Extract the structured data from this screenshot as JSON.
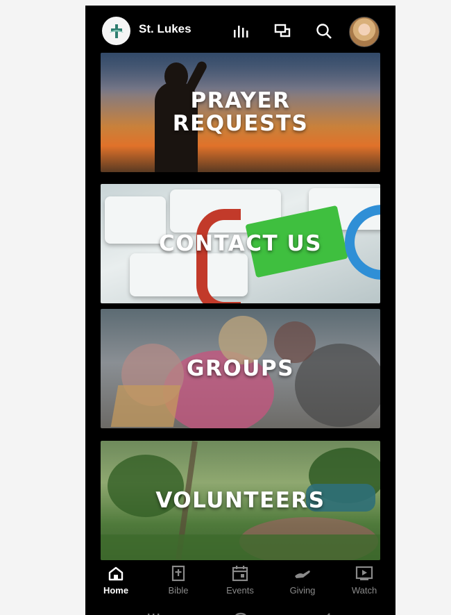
{
  "app": {
    "name": "St. Lukes",
    "logo_icon": "dove-cross-icon"
  },
  "header_icons": [
    "sermon-bars-icon",
    "chat-icon",
    "search-icon",
    "profile-avatar"
  ],
  "tiles": [
    {
      "title_line1": "PRAYER",
      "title_line2": "REQUESTS"
    },
    {
      "title": "CONTACT US"
    },
    {
      "title": "GROUPS"
    },
    {
      "title": "VOLUNTEERS"
    }
  ],
  "nav": {
    "items": [
      {
        "label": "Home",
        "icon": "home-icon",
        "active": true
      },
      {
        "label": "Bible",
        "icon": "bible-icon",
        "active": false
      },
      {
        "label": "Events",
        "icon": "calendar-icon",
        "active": false
      },
      {
        "label": "Giving",
        "icon": "giving-hand-icon",
        "active": false
      },
      {
        "label": "Watch",
        "icon": "play-icon",
        "active": false
      }
    ]
  },
  "colors": {
    "background": "#000000",
    "nav_active": "#ffffff",
    "nav_inactive": "#8a8a8a"
  }
}
